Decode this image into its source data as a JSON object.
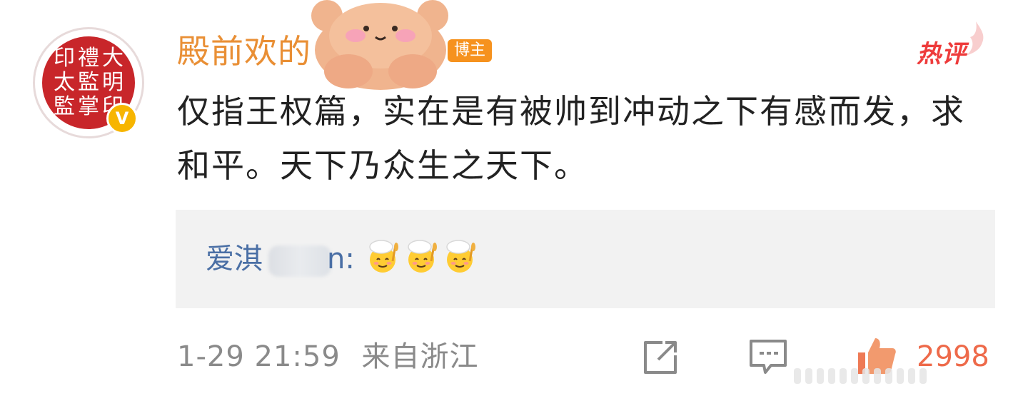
{
  "colors": {
    "username": "#e98f35",
    "role_badge_bg": "#f6921e",
    "hot": "#ee3b3b",
    "comment_text": "#222222",
    "reply_user": "#4a6fa5",
    "reply_bg": "#f2f2f2",
    "meta_text": "#8a8a8a",
    "like": "#ee6a4a",
    "verified": "#f7b500"
  },
  "avatar": {
    "seal_chars": [
      "印",
      "禮",
      "大",
      "太",
      "監",
      "明",
      "監",
      "掌",
      "印"
    ],
    "verified_mark": "V"
  },
  "header": {
    "username": "殿前欢的",
    "role_badge": "博主",
    "hot_label": "热评"
  },
  "comment": {
    "text": "仅指王权篇，实在是有被帅到冲动之下有感而发，求和平。天下乃众生之天下。"
  },
  "reply": {
    "user_prefix": "爱淇",
    "user_suffix": "n:",
    "emojis": [
      "smiling-face-with-chef-hat-and-wheat",
      "smiling-face-with-chef-hat-and-wheat",
      "smiling-face-with-chef-hat-and-wheat"
    ]
  },
  "footer": {
    "time": "1-29 21:59",
    "location": "来自浙江",
    "share_icon": "share-icon",
    "comment_icon": "comment-icon",
    "like_icon": "like-icon",
    "like_count": "2998"
  }
}
